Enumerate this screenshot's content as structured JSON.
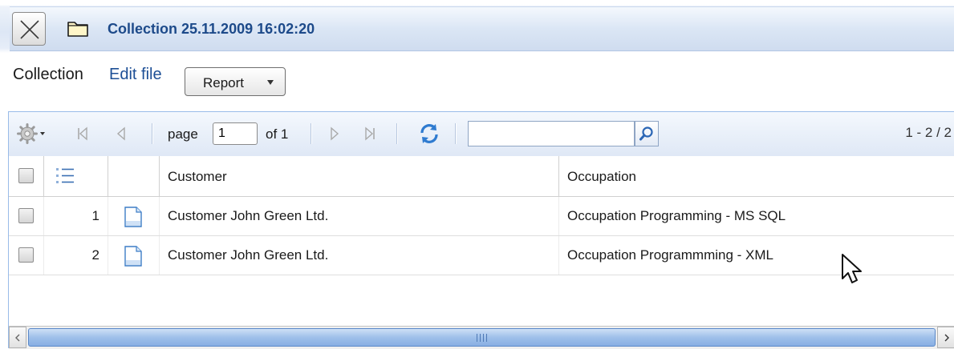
{
  "window": {
    "title": "Collection 25.11.2009 16:02:20",
    "close_icon": "close-x-icon",
    "folder_icon": "folder-icon"
  },
  "menu": {
    "label": "Collection",
    "edit_link": "Edit file",
    "report_button": "Report"
  },
  "toolbar": {
    "page_label": "page",
    "page_value": "1",
    "of_label": "of 1",
    "search_value": "",
    "range_text": "1 - 2 / 2"
  },
  "grid": {
    "columns": [
      "Customer",
      "Occupation"
    ],
    "rows": [
      {
        "num": "1",
        "customer": "Customer John Green Ltd.",
        "occupation": "Occupation Programming - MS SQL"
      },
      {
        "num": "2",
        "customer": "Customer John Green Ltd.",
        "occupation": "Occupation Programmming - XML"
      }
    ]
  },
  "colors": {
    "title_text": "#1d4a8a",
    "link": "#1d4f96",
    "grid_border": "#99bbe8"
  }
}
